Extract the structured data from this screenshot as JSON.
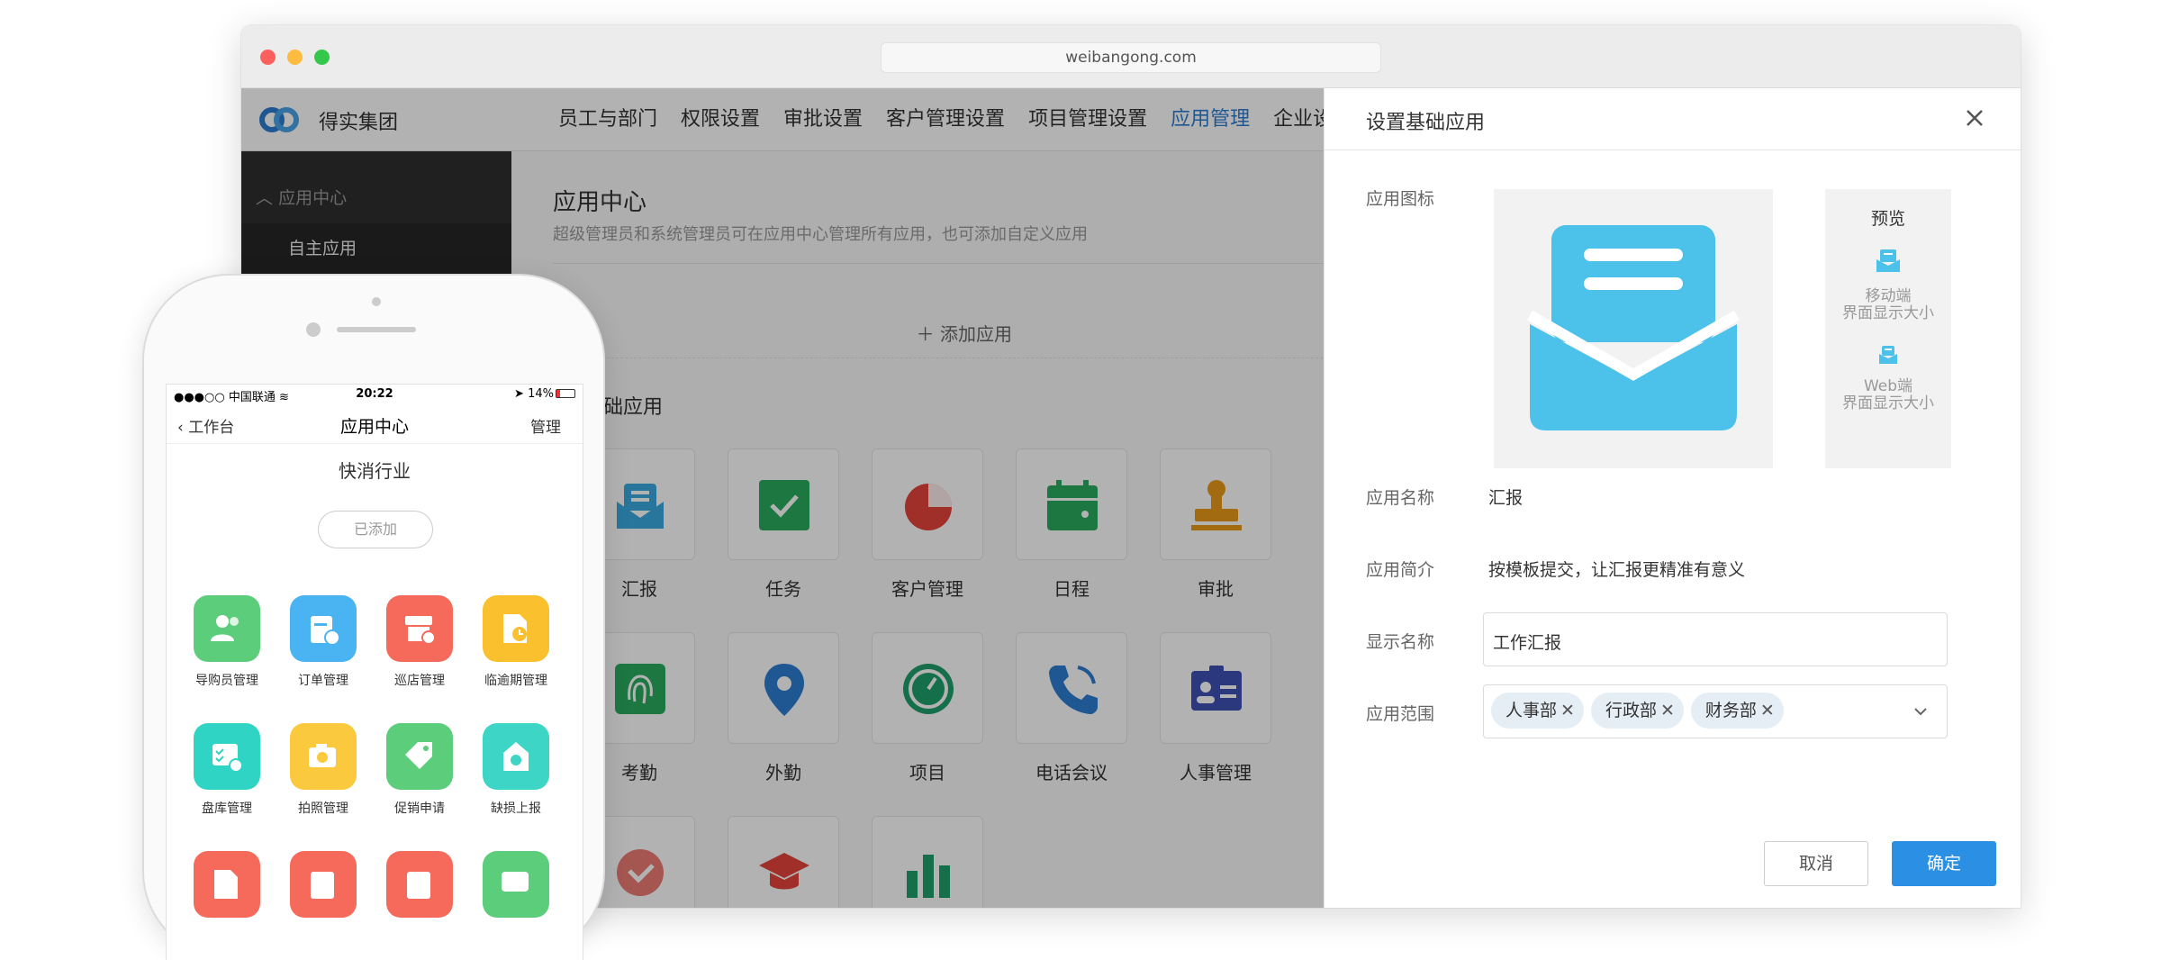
{
  "browser": {
    "url": "weibangong.com"
  },
  "topnav": {
    "brand": "得实集团",
    "items": [
      "员工与部门",
      "权限设置",
      "审批设置",
      "客户管理设置",
      "项目管理设置",
      "应用管理",
      "企业设"
    ],
    "active_index": 5
  },
  "sidebar": {
    "group_label": "应用中心",
    "items": [
      "自主应用"
    ]
  },
  "main": {
    "title": "应用中心",
    "subtitle": "超级管理员和系统管理员可在应用中心管理所有应用，也可添加自定义应用",
    "add_button": "添加应用",
    "section_title": "基础应用",
    "apps": [
      {
        "label": "汇报",
        "icon": "report-icon",
        "color": "#3aa9e0"
      },
      {
        "label": "任务",
        "icon": "task-icon",
        "color": "#2aab5e"
      },
      {
        "label": "客户管理",
        "icon": "customer-icon",
        "color": "#e4443a"
      },
      {
        "label": "日程",
        "icon": "calendar-icon",
        "color": "#2aab5e"
      },
      {
        "label": "审批",
        "icon": "stamp-icon",
        "color": "#e89a1a"
      },
      {
        "label": "考勤",
        "icon": "fingerprint-icon",
        "color": "#2aab5e"
      },
      {
        "label": "外勤",
        "icon": "location-pin-icon",
        "color": "#2d7dd2"
      },
      {
        "label": "项目",
        "icon": "gauge-icon",
        "color": "#1fa06b"
      },
      {
        "label": "电话会议",
        "icon": "phone-call-icon",
        "color": "#2d7dd2"
      },
      {
        "label": "人事管理",
        "icon": "id-card-icon",
        "color": "#3f51b5"
      },
      {
        "label": "",
        "icon": "badge-icon",
        "color": "#e4443a"
      },
      {
        "label": "",
        "icon": "graduation-cap-icon",
        "color": "#e4443a"
      },
      {
        "label": "",
        "icon": "bar-chart-icon",
        "color": "#1fa06b"
      }
    ]
  },
  "panel": {
    "title": "设置基础应用",
    "icon_label": "应用图标",
    "preview": {
      "title": "预览",
      "mobile_label_1": "移动端",
      "mobile_label_2": "界面显示大小",
      "web_label_1": "Web端",
      "web_label_2": "界面显示大小"
    },
    "name_label": "应用名称",
    "name_value": "汇报",
    "intro_label": "应用简介",
    "intro_value": "按模板提交，让汇报更精准有意义",
    "display_label": "显示名称",
    "display_value": "工作汇报",
    "scope_label": "应用范围",
    "scope_chips": [
      "人事部",
      "行政部",
      "财务部"
    ],
    "cancel": "取消",
    "confirm": "确定",
    "accent": "#2b8fe3",
    "icon_color": "#4cc2ea"
  },
  "phone": {
    "carrier": "●●●○○ 中国联通",
    "time": "20:22",
    "status_right": "14%",
    "back_label": "工作台",
    "title": "应用中心",
    "manage": "管理",
    "industry": "快消行业",
    "added": "已添加",
    "apps": [
      {
        "label": "导购员管理",
        "icon": "people-icon",
        "color": "#5ccd7a"
      },
      {
        "label": "订单管理",
        "icon": "order-icon",
        "color": "#4ab4f2"
      },
      {
        "label": "巡店管理",
        "icon": "shop-icon",
        "color": "#f56a5b"
      },
      {
        "label": "临逾期管理",
        "icon": "expiry-icon",
        "color": "#fbc02d"
      },
      {
        "label": "盘库管理",
        "icon": "inventory-icon",
        "color": "#2fd4c4"
      },
      {
        "label": "拍照管理",
        "icon": "camera-icon",
        "color": "#fbc93d"
      },
      {
        "label": "促销申请",
        "icon": "tag-icon",
        "color": "#5ccd7a"
      },
      {
        "label": "缺损上报",
        "icon": "damage-icon",
        "color": "#3dd6c6"
      },
      {
        "label": "",
        "icon": "doc-plus-icon",
        "color": "#f56a5b"
      },
      {
        "label": "",
        "icon": "clipboard-icon",
        "color": "#f56a5b"
      },
      {
        "label": "",
        "icon": "clipboard-list-icon",
        "color": "#f56a5b"
      },
      {
        "label": "",
        "icon": "chat-icon",
        "color": "#5ccd7a"
      }
    ]
  }
}
